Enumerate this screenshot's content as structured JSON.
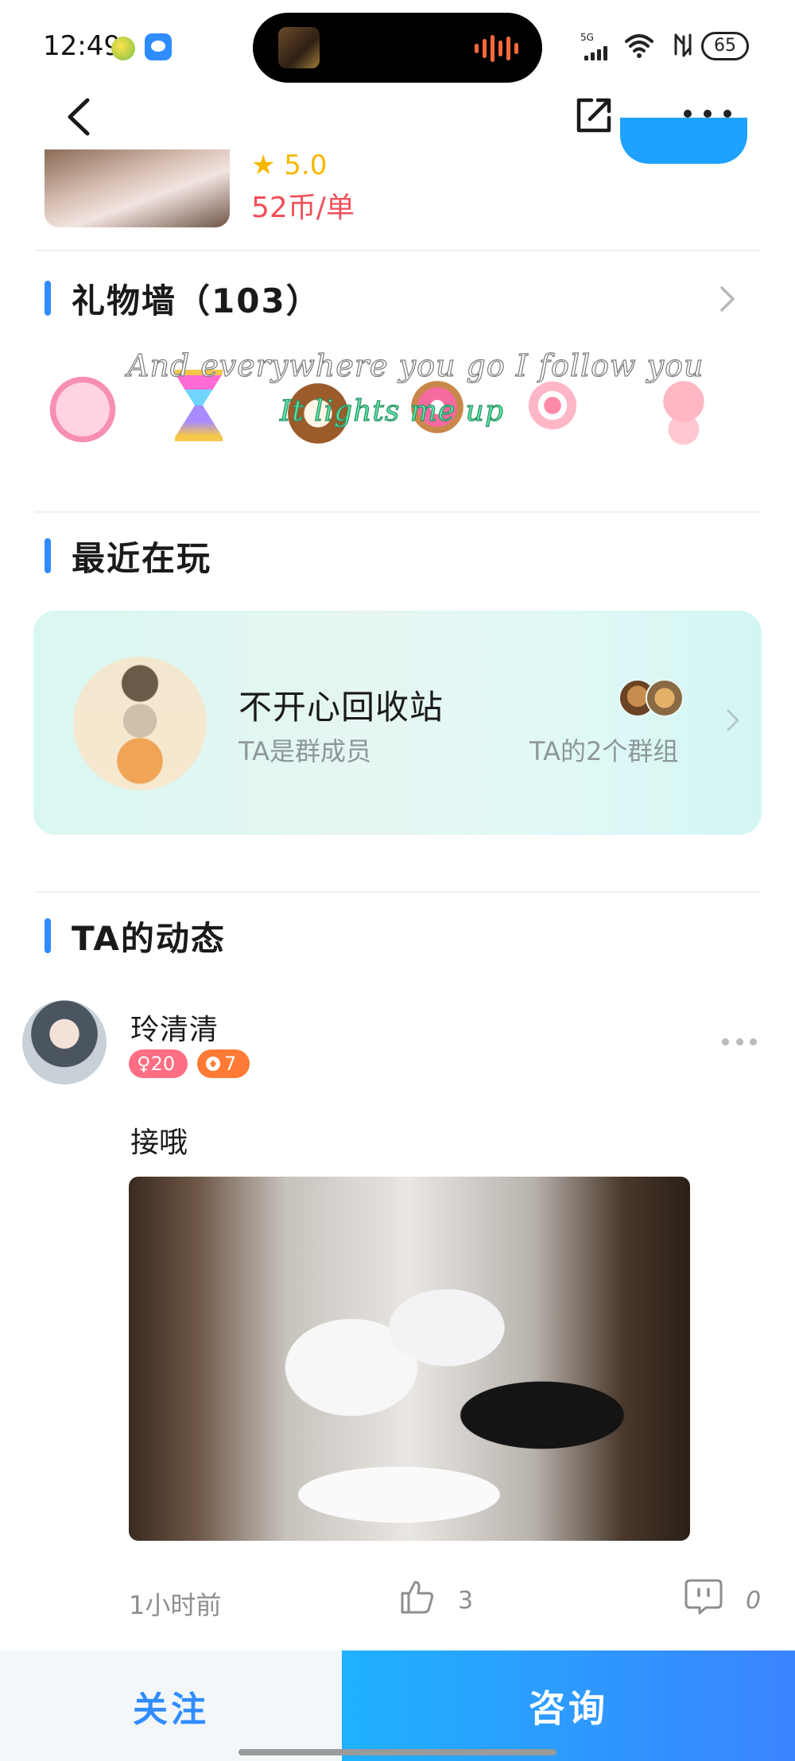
{
  "status_bar": {
    "time": "12:49",
    "network": "5G",
    "battery": "65"
  },
  "nav": {
    "back_icon": "chevron-left-icon",
    "share_icon": "share-icon",
    "more_icon": "more-dots-icon"
  },
  "service": {
    "rating": "★ 5.0",
    "price": "52币/单"
  },
  "gift_wall": {
    "title": "礼物墙（103）",
    "lyric_line1": "And everywhere you go I follow you",
    "lyric_line2": "It lights me up",
    "gifts": [
      "cat-gift",
      "hourglass-gift",
      "coconut-gift",
      "donut-gift",
      "cake-roll-gift",
      "pig-gift"
    ]
  },
  "recently_playing": {
    "title": "最近在玩",
    "group_name": "不开心回收站",
    "role": "TA是群成员",
    "groups_link": "TA的2个群组"
  },
  "feed": {
    "title": "TA的动态",
    "post": {
      "username": "玲清清",
      "gender_badge": "♀20",
      "level_badge": "7",
      "text": "接哦",
      "time": "1小时前",
      "likes": "3",
      "comments": "0"
    }
  },
  "bottom_bar": {
    "follow_label": "关注",
    "consult_label": "咨询"
  },
  "colors": {
    "accent": "#2f8cff",
    "price_red": "#f0505a",
    "star_yellow": "#f5b800",
    "consult_gradient_start": "#1fb1ff",
    "consult_gradient_end": "#3b84ff"
  }
}
